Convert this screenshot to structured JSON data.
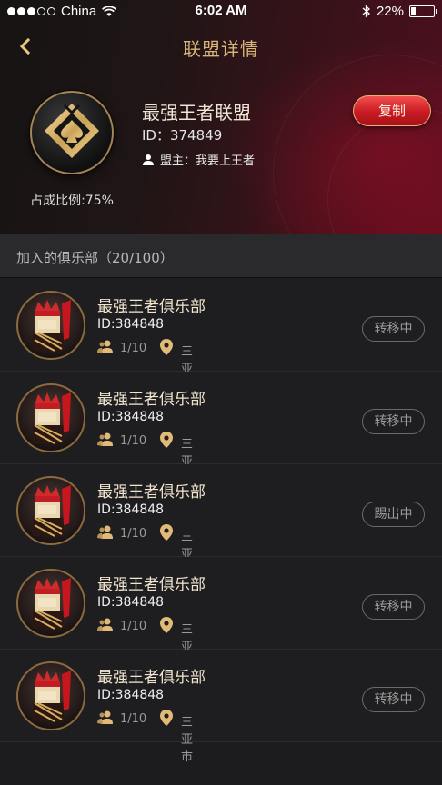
{
  "status_bar": {
    "carrier": "China",
    "time": "6:02 AM",
    "battery_text": "22%",
    "battery_level": 0.22
  },
  "nav": {
    "title": "联盟详情",
    "back_icon": "chevron-left-icon"
  },
  "alliance": {
    "name": "最强王者联盟",
    "id_text": "ID：374849",
    "leader_text": "盟主：我要上王者",
    "ratio_text": "占成比例:75%",
    "copy_label": "复制"
  },
  "section": {
    "title": "加入的俱乐部（20/100）"
  },
  "clubs": [
    {
      "name": "最强王者俱乐部",
      "id_text": "ID:384848",
      "members": "1/10",
      "city": "三亚市",
      "status": "转移中"
    },
    {
      "name": "最强王者俱乐部",
      "id_text": "ID:384848",
      "members": "1/10",
      "city": "三亚市",
      "status": "转移中"
    },
    {
      "name": "最强王者俱乐部",
      "id_text": "ID:384848",
      "members": "1/10",
      "city": "三亚市",
      "status": "踢出中"
    },
    {
      "name": "最强王者俱乐部",
      "id_text": "ID:384848",
      "members": "1/10",
      "city": "三亚市",
      "status": "转移中"
    },
    {
      "name": "最强王者俱乐部",
      "id_text": "ID:384848",
      "members": "1/10",
      "city": "三亚市",
      "status": "转移中"
    }
  ],
  "colors": {
    "gold": "#d8b579",
    "red_button": "#c81a22",
    "list_bg": "#1e1e20",
    "section_bg": "#2a2a2c"
  }
}
